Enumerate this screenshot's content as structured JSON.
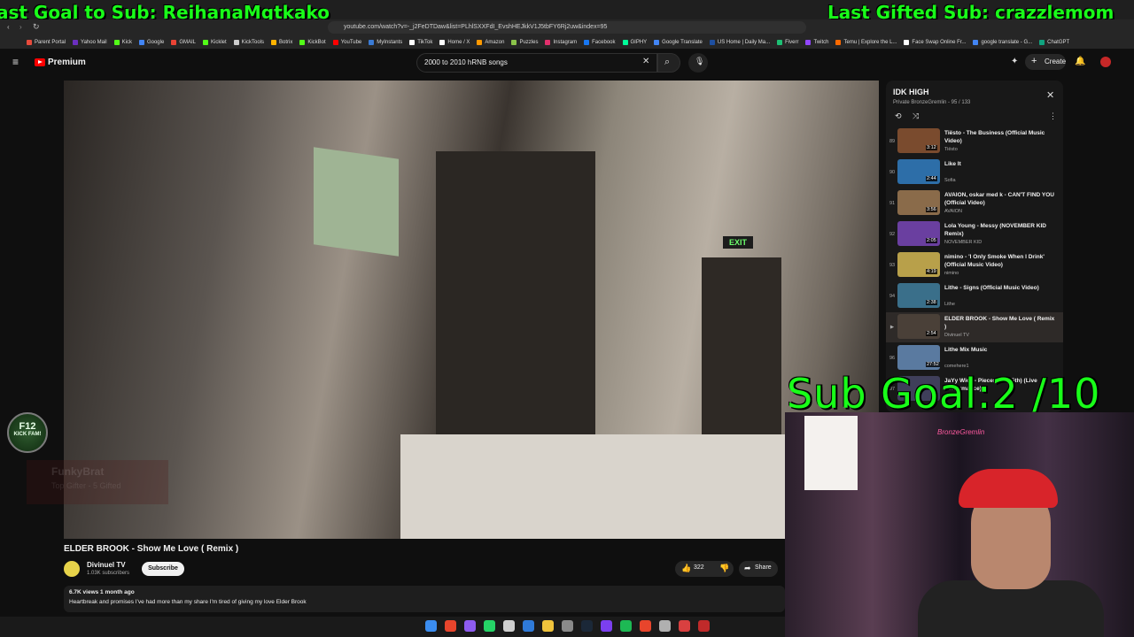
{
  "overlay": {
    "left_text": "ast Goal to Sub: ReihanaMgtkako",
    "right_text": "Last Gifted Sub: crazzlemom",
    "sub_goal": "Sub Goal:2 /10",
    "badge_line1": "F12",
    "badge_line2": "KICK FAM!",
    "ghost_title": "FunkyBrat",
    "ghost_sub": "Top Gifter - 5 Gifted",
    "cam_name": "BronzeGremlin"
  },
  "browser": {
    "url": "youtube.com/watch?v=-_j2FeDTDaw&list=PLhlSXXFdI_EvshHEJkkV1J5tbFY6Rj2uw&index=95",
    "bookmarks": [
      {
        "label": "Parent Portal",
        "color": "#e84b3c"
      },
      {
        "label": "Yahoo Mail",
        "color": "#6b2fbf"
      },
      {
        "label": "Kick",
        "color": "#53fc18"
      },
      {
        "label": "Google",
        "color": "#4285f4"
      },
      {
        "label": "GMAIL",
        "color": "#ea4335"
      },
      {
        "label": "Kicklet",
        "color": "#53fc18"
      },
      {
        "label": "KickTools",
        "color": "#cccccc"
      },
      {
        "label": "Botrix",
        "color": "#ffb300"
      },
      {
        "label": "KickBot",
        "color": "#53fc18"
      },
      {
        "label": "YouTube",
        "color": "#ff0000"
      },
      {
        "label": "MyInstants",
        "color": "#3a7bd5"
      },
      {
        "label": "TikTok",
        "color": "#ffffff"
      },
      {
        "label": "Home / X",
        "color": "#ffffff"
      },
      {
        "label": "Amazon",
        "color": "#ff9900"
      },
      {
        "label": "Puzzles",
        "color": "#8bc34a"
      },
      {
        "label": "Instagram",
        "color": "#e1306c"
      },
      {
        "label": "Facebook",
        "color": "#1877f2"
      },
      {
        "label": "GIPHY",
        "color": "#00ff99"
      },
      {
        "label": "Google Translate",
        "color": "#4285f4"
      },
      {
        "label": "US Home | Daily Ma...",
        "color": "#1e4fa0"
      },
      {
        "label": "Fiverr",
        "color": "#1dbf73"
      },
      {
        "label": "Twitch",
        "color": "#9146ff"
      },
      {
        "label": "Temu | Explore the L...",
        "color": "#ff6a00"
      },
      {
        "label": "Face Swap Online Fr...",
        "color": "#ffffff"
      },
      {
        "label": "google translate - G...",
        "color": "#4285f4"
      },
      {
        "label": "ChatGPT",
        "color": "#10a37f"
      }
    ]
  },
  "youtube": {
    "logo_label": "Premium",
    "search_value": "2000 to 2010 hRNB songs",
    "create_label": "Create",
    "video": {
      "exit_sign": "EXIT",
      "title": "ELDER BROOK - Show Me Love ( Remix )",
      "channel": "Divinuel TV",
      "subscribers": "1.03K subscribers",
      "subscribe_label": "Subscribe",
      "likes": "322",
      "share_label": "Share",
      "meta": "6.7K views  1 month ago",
      "description": "Heartbreak and promises I've had more than my share  I'm tired of giving my love Elder Brook"
    },
    "playlist": {
      "title": "IDK HIGH",
      "subtitle": "Private  BronzeGremlin - 95 / 133",
      "items": [
        {
          "index": "89",
          "title": "Tiësto - The Business (Official Music Video)",
          "artist": "Tiësto",
          "duration": "3:12",
          "color": "#7a4b2e"
        },
        {
          "index": "90",
          "title": "Like It",
          "artist": "Sofia",
          "duration": "2:44",
          "color": "#2d6ea8"
        },
        {
          "index": "91",
          "title": "AVAION, oskar med k - CAN'T FIND YOU (Official Video)",
          "artist": "AVAION",
          "duration": "3:56",
          "color": "#8a6b4a"
        },
        {
          "index": "92",
          "title": "Lola Young - Messy (NOVEMBER KID Remix)",
          "artist": "NOVEMBER KID",
          "duration": "2:05",
          "color": "#6a3fa0"
        },
        {
          "index": "93",
          "title": "nimino - 'I Only Smoke When I Drink' (Official Music Video)",
          "artist": "nimino",
          "duration": "4:19",
          "color": "#b8a04a"
        },
        {
          "index": "94",
          "title": "Lithe - Signs (Official Music Video)",
          "artist": "Lithe",
          "duration": "2:38",
          "color": "#3a6f8a"
        },
        {
          "index": "",
          "title": "ELDER BROOK - Show Me Love ( Remix )",
          "artist": "Divinuel TV",
          "duration": "2:54",
          "color": "#4a4038"
        },
        {
          "index": "96",
          "title": "Lithe Mix Music",
          "artist": "comehere1",
          "duration": "27:52",
          "color": "#5a7aa0"
        },
        {
          "index": "97",
          "title": "JaYy Wick - Pieces (The 5th) (Live Performance)",
          "artist": "",
          "duration": "",
          "color": "#3f3f5a"
        }
      ]
    }
  },
  "colors": {
    "overlay_green": "#19ff19",
    "yt_red": "#ff0000",
    "background": "#0f0f0f"
  }
}
